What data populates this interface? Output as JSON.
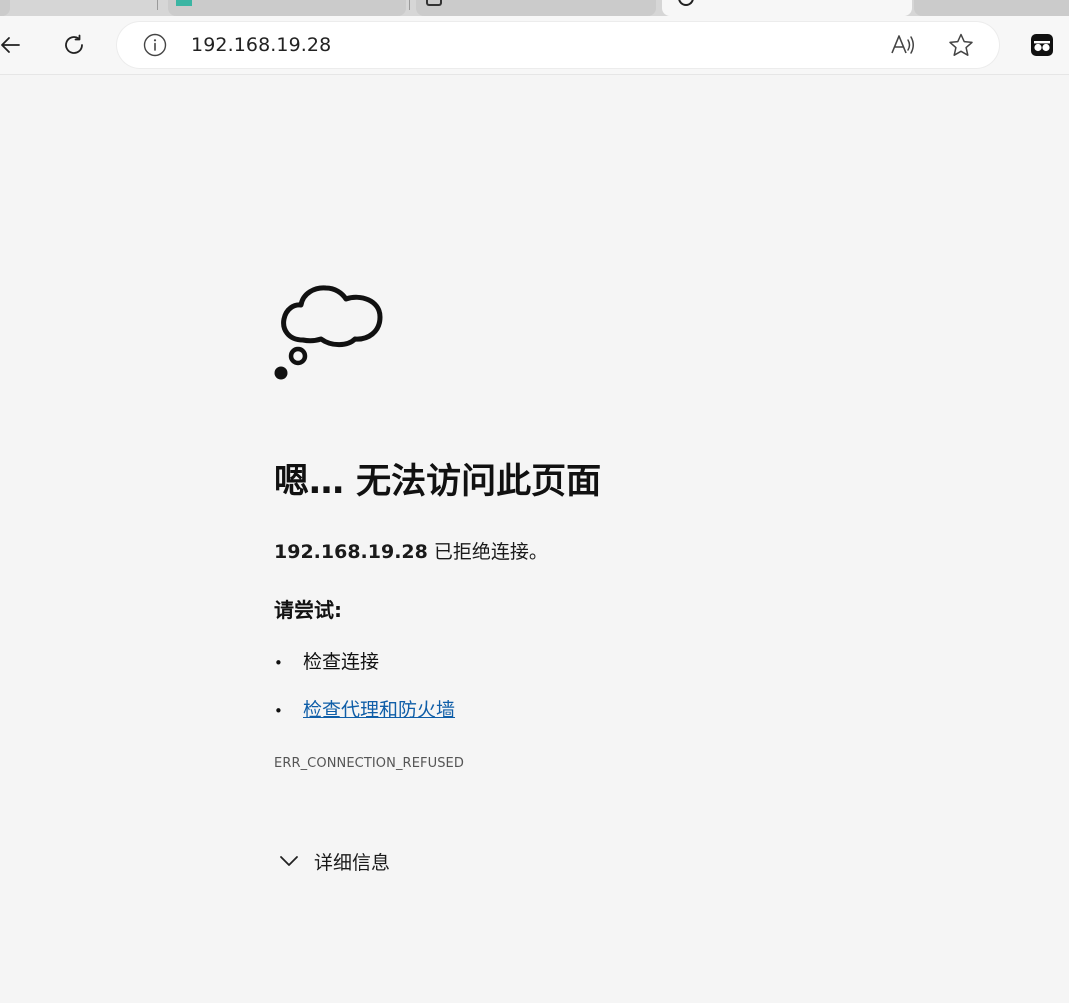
{
  "browser": {
    "address_bar": {
      "url": "192.168.19.28"
    },
    "toolbar_icons": [
      "back-arrow-icon",
      "refresh-icon",
      "site-info-icon",
      "read-aloud-icon",
      "favorite-star-icon",
      "extension-icon"
    ]
  },
  "error_page": {
    "icon": "thought-cloud-icon",
    "title": "嗯… 无法访问此页面",
    "host": "192.168.19.28",
    "message_suffix": " 已拒绝连接。",
    "try_heading": "请尝试:",
    "suggestions": [
      {
        "label": "检查连接",
        "is_link": false
      },
      {
        "label": "检查代理和防火墙",
        "is_link": true
      }
    ],
    "error_code": "ERR_CONNECTION_REFUSED",
    "details_label": "详细信息"
  },
  "colors": {
    "page_background": "#f5f5f5",
    "link": "#0f5ea8",
    "error_code_text": "#555555"
  }
}
